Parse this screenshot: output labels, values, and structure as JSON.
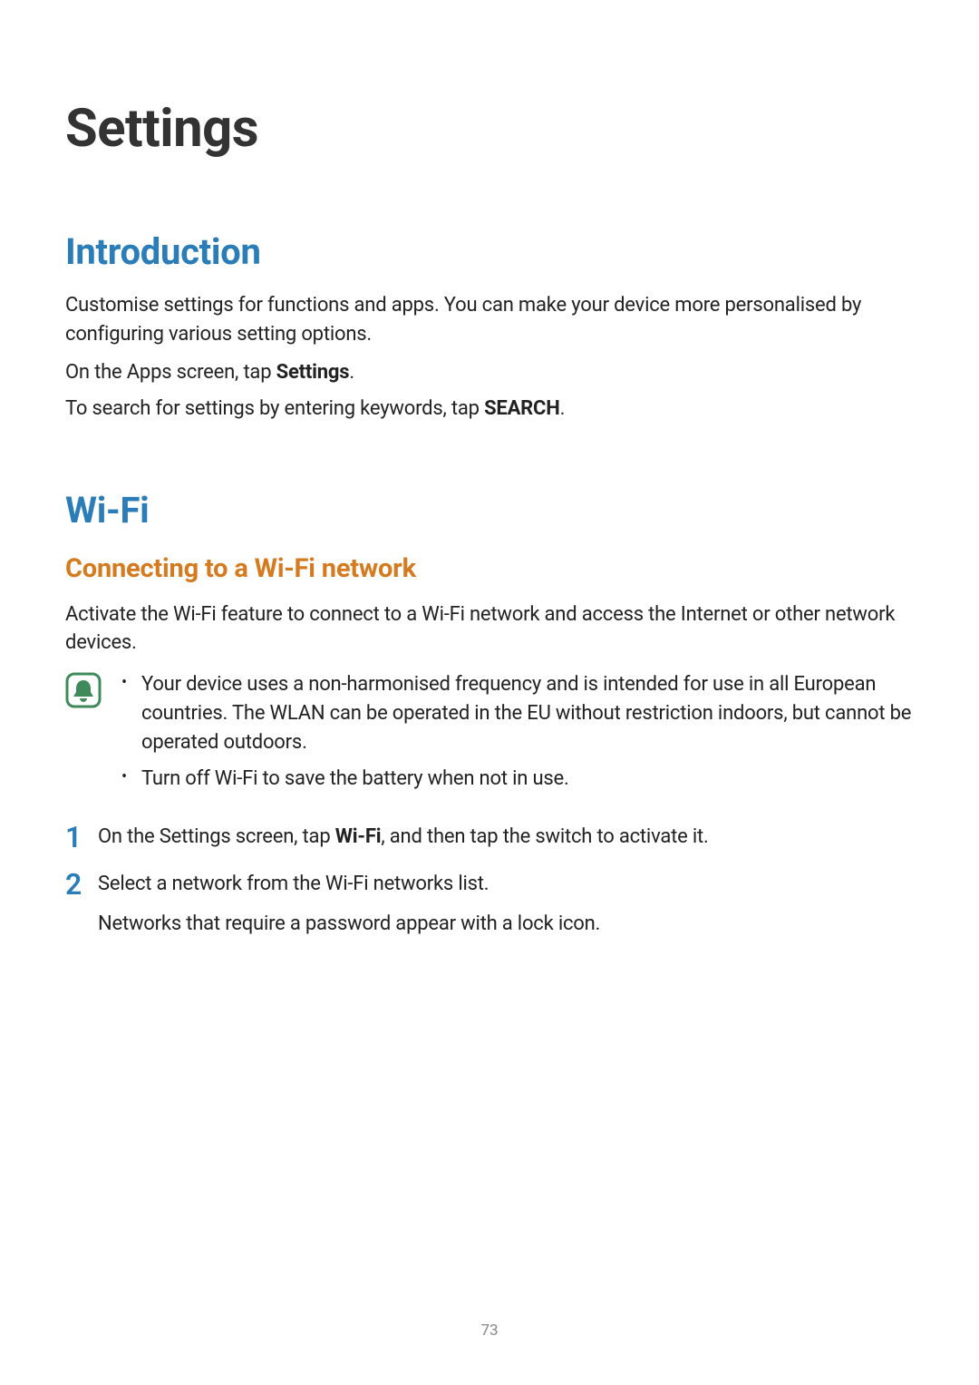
{
  "page_title": "Settings",
  "intro": {
    "heading": "Introduction",
    "para1": "Customise settings for functions and apps. You can make your device more personalised by configuring various setting options.",
    "para2_pre": "On the Apps screen, tap ",
    "para2_bold": "Settings",
    "para2_post": ".",
    "para3_pre": "To search for settings by entering keywords, tap ",
    "para3_bold": "SEARCH",
    "para3_post": "."
  },
  "wifi": {
    "heading": "Wi-Fi",
    "sub_heading": "Connecting to a Wi-Fi network",
    "intro": "Activate the Wi-Fi feature to connect to a Wi-Fi network and access the Internet or other network devices.",
    "note_bullets": [
      "Your device uses a non-harmonised frequency and is intended for use in all European countries. The WLAN can be operated in the EU without restriction indoors, but cannot be operated outdoors.",
      "Turn off Wi-Fi to save the battery when not in use."
    ],
    "steps": [
      {
        "num": "1",
        "text_pre": "On the Settings screen, tap ",
        "text_bold": "Wi-Fi",
        "text_post": ", and then tap the switch to activate it.",
        "subtext": ""
      },
      {
        "num": "2",
        "text_pre": "Select a network from the Wi-Fi networks list.",
        "text_bold": "",
        "text_post": "",
        "subtext": "Networks that require a password appear with a lock icon."
      }
    ]
  },
  "bullet_char": "•",
  "page_number": "73",
  "colors": {
    "section_blue": "#2a7db8",
    "sub_orange": "#d67a1f",
    "note_green": "#3f8a5a"
  }
}
